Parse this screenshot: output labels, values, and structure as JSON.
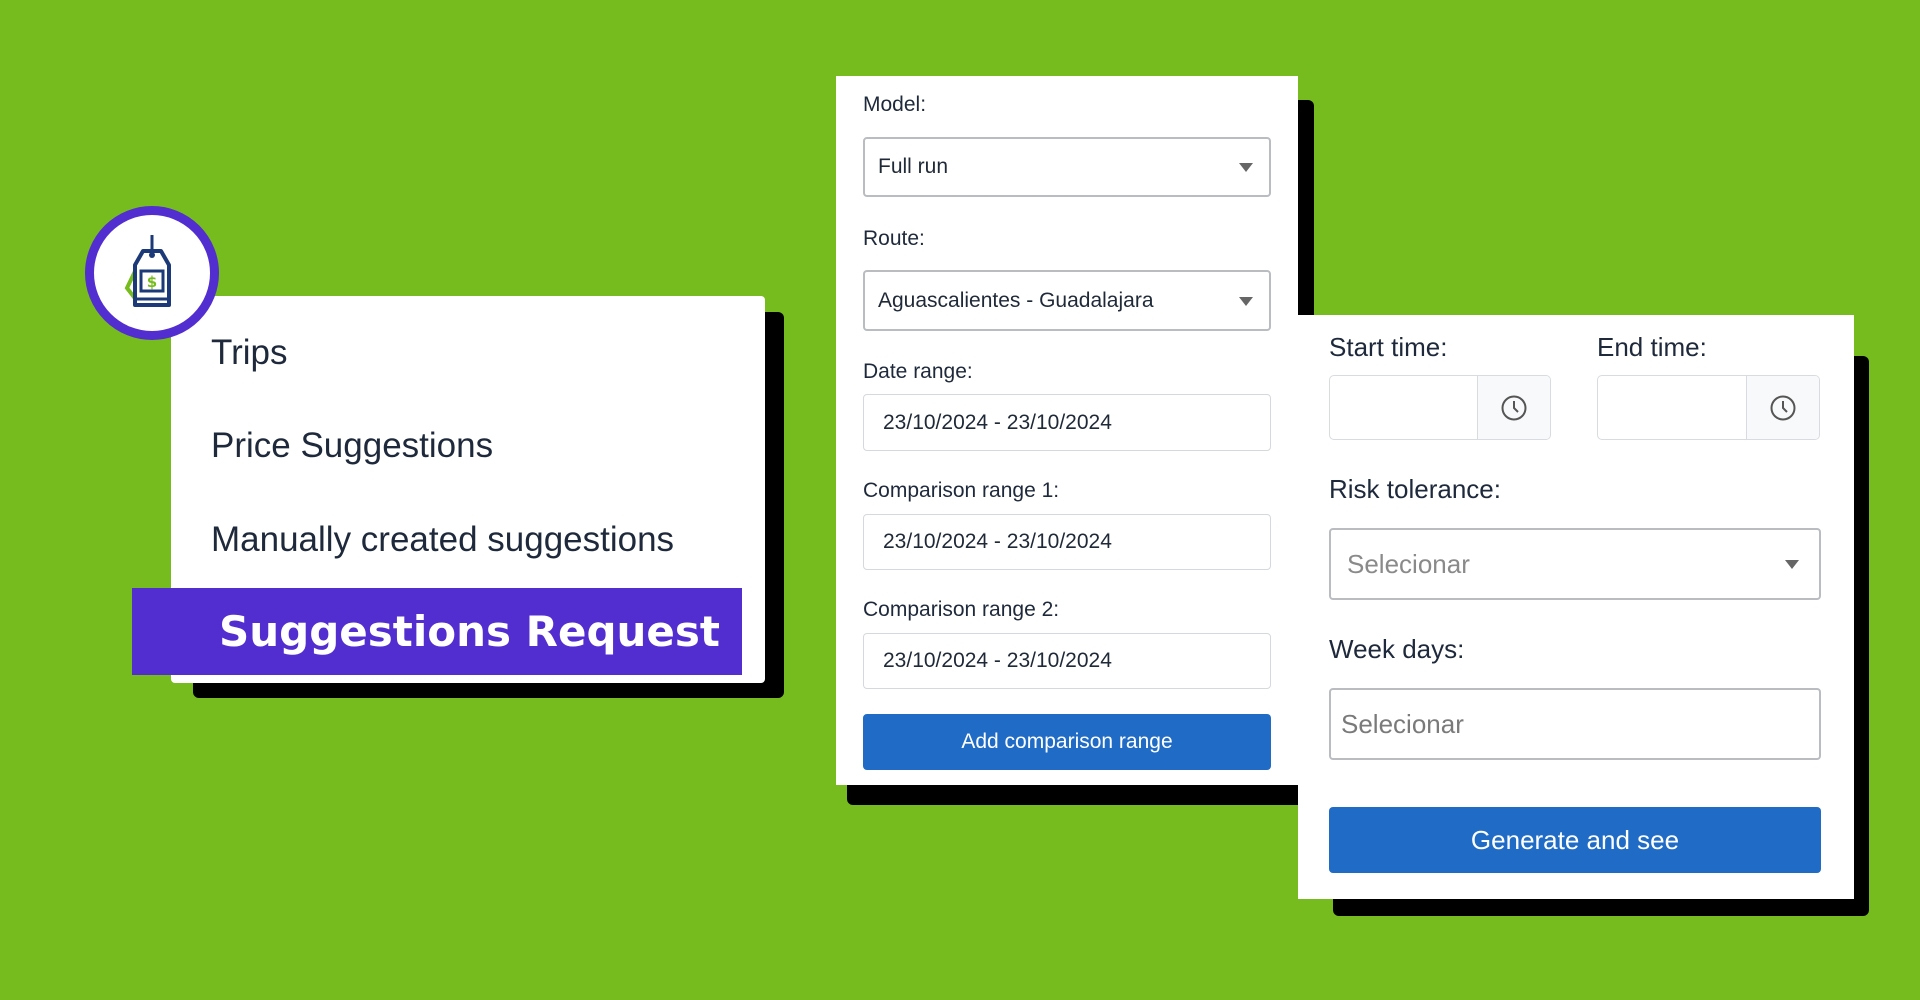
{
  "colors": {
    "background": "#77bc1f",
    "accent_purple": "#522dd0",
    "button_blue": "#1f6bc6"
  },
  "menu": {
    "logo_icon": "price-tag-dollar-icon",
    "items": [
      {
        "label": "Trips"
      },
      {
        "label": "Price Suggestions"
      },
      {
        "label": "Manually created suggestions"
      },
      {
        "label": "Suggestions Request",
        "active": true
      }
    ]
  },
  "form": {
    "model": {
      "label": "Model:",
      "value": "Full run"
    },
    "route": {
      "label": "Route:",
      "value": "Aguascalientes - Guadalajara"
    },
    "date_range": {
      "label": "Date range:",
      "value": "23/10/2024 - 23/10/2024"
    },
    "comparison_1": {
      "label": "Comparison range 1:",
      "value": "23/10/2024 - 23/10/2024"
    },
    "comparison_2": {
      "label": "Comparison range 2:",
      "value": "23/10/2024 - 23/10/2024"
    },
    "add_button": "Add comparison range"
  },
  "options": {
    "start_time": {
      "label": "Start time:",
      "value": ""
    },
    "end_time": {
      "label": "End time:",
      "value": ""
    },
    "risk": {
      "label": "Risk tolerance:",
      "placeholder": "Selecionar"
    },
    "week_days": {
      "label": "Week days:",
      "placeholder": "Selecionar"
    },
    "generate_button": "Generate and see"
  }
}
